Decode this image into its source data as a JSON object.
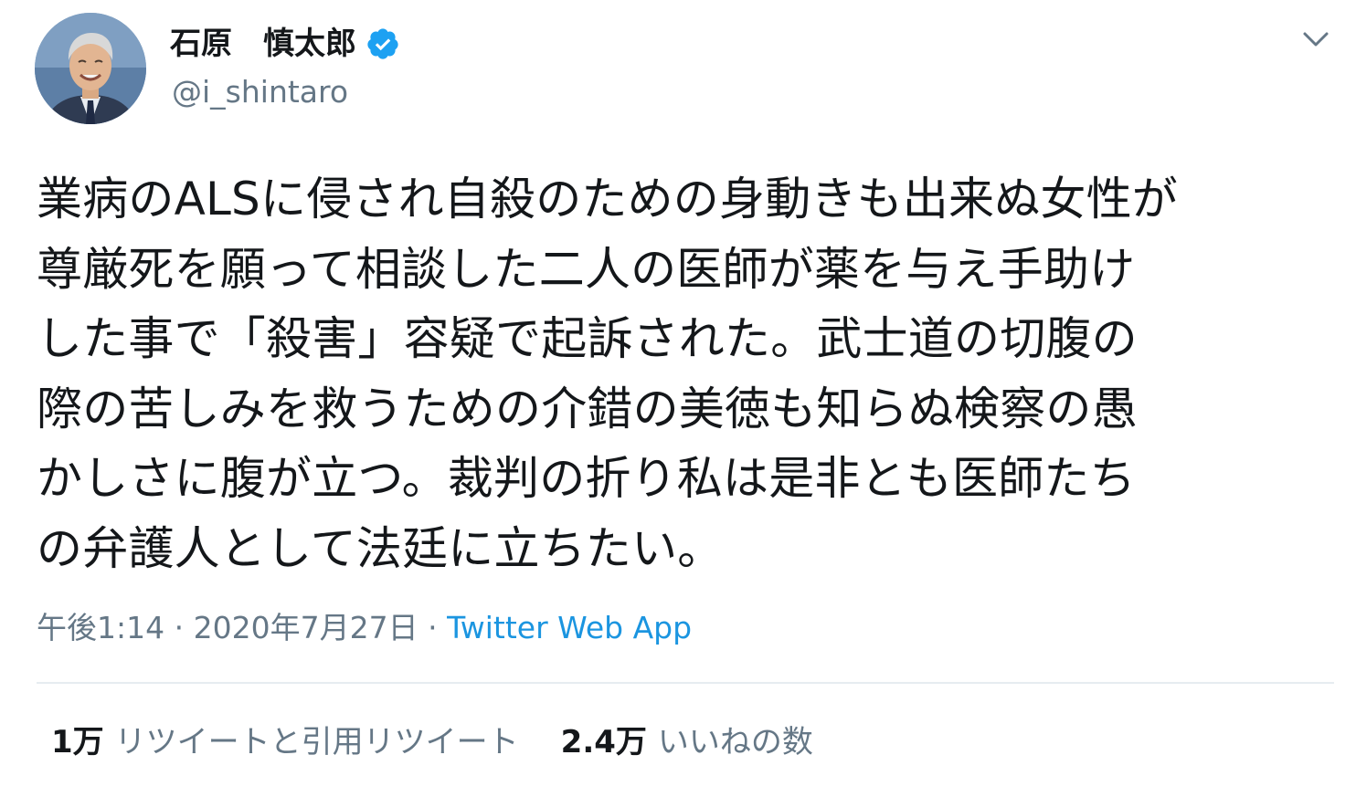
{
  "user": {
    "display_name": "石原　慎太郎",
    "handle": "@i_shintaro",
    "verified": true
  },
  "tweet": {
    "lines": [
      "業病のALSに侵され自殺のための身動きも出来ぬ女性が",
      "尊厳死を願って相談した二人の医師が薬を与え手助け",
      "した事で「殺害」容疑で起訴された。武士道の切腹の",
      "際の苦しみを救うための介錯の美徳も知らぬ検察の愚",
      "かしさに腹が立つ。裁判の折り私は是非とも医師たち",
      "の弁護人として法廷に立ちたい。"
    ],
    "time": "午後1:14",
    "date": "2020年7月27日",
    "separator": "·",
    "source": "Twitter Web App"
  },
  "stats": {
    "retweets_count": "1万",
    "retweets_label": "リツイートと引用リツイート",
    "likes_count": "2.4万",
    "likes_label": "いいねの数"
  },
  "icons": {
    "verified": "verified-badge-icon",
    "caret": "chevron-down-icon"
  },
  "colors": {
    "text": "#14171a",
    "secondary": "#657786",
    "link": "#1b95e0",
    "verified": "#1da1f2",
    "divider": "#e6ecf0"
  }
}
